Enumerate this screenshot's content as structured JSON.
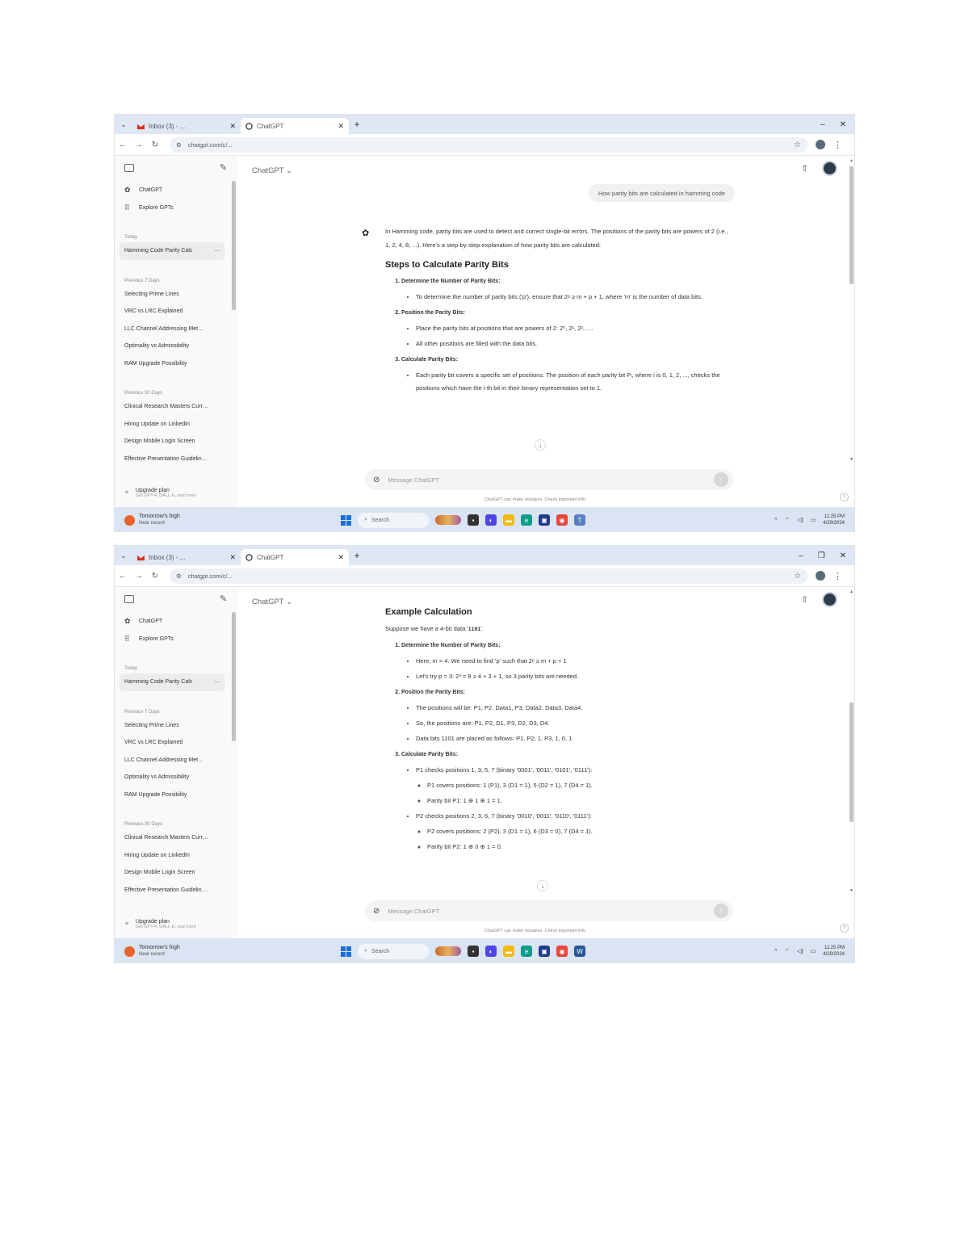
{
  "screenshots": [
    {
      "browser": {
        "tabs": [
          {
            "title": "Inbox (3) - ...",
            "active": false
          },
          {
            "title": "ChatGPT",
            "active": true
          }
        ],
        "url": "chatgpt.com/c/..."
      },
      "sidebar": {
        "items": [
          {
            "icon": "chatgpt-icon",
            "label": "ChatGPT"
          },
          {
            "icon": "explore-icon",
            "label": "Explore GPTs"
          }
        ],
        "groups": [
          {
            "label": "Today",
            "items": [
              "Hamming Code Parity Calc"
            ]
          },
          {
            "label": "Previous 7 Days",
            "items": [
              "Selecting Prime Lines",
              "VRC vs LRC Explained",
              "LLC Channel Addressing Met…",
              "Optimality vs Admissibility",
              "RAM Upgrade Possibility"
            ]
          },
          {
            "label": "Previous 30 Days",
            "items": [
              "Clinical Research Masters Curr…",
              "Hiring Update on LinkedIn",
              "Design Mobile Login Screen",
              "Effective Presentation Guidelin…"
            ]
          }
        ],
        "upgrade": {
          "title": "Upgrade plan",
          "subtitle": "Get GPT-4, DALL·E, and more"
        }
      },
      "main": {
        "model": "ChatGPT",
        "user_message": "How parity bits are calculated in hamming code",
        "intro": "In Hamming code, parity bits are used to detect and correct single-bit errors. The positions of the parity bits are powers of 2 (i.e., 1, 2, 4, 8, ...). Here's a step-by-step explanation of how parity bits are calculated:",
        "heading": "Steps to Calculate Parity Bits",
        "steps": [
          {
            "title": "Determine the Number of Parity Bits:",
            "bullets": [
              "To determine the number of parity bits ('p'), ensure that 2ᵖ ≥ m + p + 1, where 'm' is the number of data bits."
            ]
          },
          {
            "title": "Position the Parity Bits:",
            "bullets": [
              "Place the parity bits at positions that are powers of 2: 2⁰, 2¹, 2², ....",
              "All other positions are filled with the data bits."
            ]
          },
          {
            "title": "Calculate Parity Bits:",
            "bullets": [
              "Each parity bit covers a specific set of positions. The position of each parity bit Pᵢ, where i is 0, 1, 2, ..., checks the positions which have the i-th bit in their binary representation set to 1."
            ]
          }
        ],
        "composer_placeholder": "Message ChatGPT",
        "disclaimer": "ChatGPT can make mistakes. Check important info."
      },
      "taskbar": {
        "weather_title": "Tomorrow's high",
        "weather_sub": "Near record",
        "search": "Search",
        "time": "11:25 PM",
        "date": "4/29/2024"
      }
    },
    {
      "browser": {
        "tabs": [
          {
            "title": "Inbox (3) - ...",
            "active": false
          },
          {
            "title": "ChatGPT",
            "active": true
          }
        ],
        "url": "chatgpt.com/c/..."
      },
      "sidebar": {
        "items": [
          {
            "icon": "chatgpt-icon",
            "label": "ChatGPT"
          },
          {
            "icon": "explore-icon",
            "label": "Explore GPTs"
          }
        ],
        "groups": [
          {
            "label": "Today",
            "items": [
              "Hamming Code Parity Calc"
            ]
          },
          {
            "label": "Previous 7 Days",
            "items": [
              "Selecting Prime Lines",
              "VRC vs LRC Explained",
              "LLC Channel Addressing Met…",
              "Optimality vs Admissibility",
              "RAM Upgrade Possibility"
            ]
          },
          {
            "label": "Previous 30 Days",
            "items": [
              "Clinical Research Masters Curr…",
              "Hiring Update on LinkedIn",
              "Design Mobile Login Screen",
              "Effective Presentation Guidelin…"
            ]
          }
        ],
        "upgrade": {
          "title": "Upgrade plan",
          "subtitle": "Get GPT-4, DALL·E, and more"
        }
      },
      "main": {
        "model": "ChatGPT",
        "heading": "Example Calculation",
        "intro_pre": "Suppose we have a 4-bit data '",
        "intro_code": "1101",
        "intro_post": "'.",
        "steps": [
          {
            "title": "Determine the Number of Parity Bits:",
            "bullets": [
              "Here, m = 4. We need to find 'p' such that 2ᵖ ≥ m + p + 1",
              "Let's try p = 3: 2³ = 8 ≥ 4 + 3 + 1, so 3 parity bits are needed."
            ]
          },
          {
            "title": "Position the Parity Bits:",
            "bullets": [
              "The positions will be: P1, P2, Data1, P3, Data2, Data3, Data4.",
              "So, the positions are: P1, P2, D1, P3, D2, D3, D4.",
              "Data bits 1101 are placed as follows: P1, P2, 1, P3, 1, 0, 1"
            ]
          }
        ],
        "step3_title": "Calculate Parity Bits:",
        "p1": {
          "text": "P1 checks positions 1, 3, 5, 7 (binary '0001', '0011', '0101', '0111'):",
          "subs": [
            "P1 covers positions: 1 (P1), 3 (D1 = 1), 5 (D2 = 1), 7 (D4 = 1).",
            "Parity bit P1: 1 ⊕ 1 ⊕ 1 = 1."
          ]
        },
        "p2": {
          "text": "P2 checks positions 2, 3, 6, 7 (binary '0010', '0011', '0110', '0111'):",
          "subs": [
            "P2 covers positions: 2 (P2), 3 (D1 = 1), 6 (D3 = 0), 7 (D4 = 1).",
            "Parity bit P2: 1 ⊕ 0 ⊕ 1 = 0."
          ]
        },
        "composer_placeholder": "Message ChatGPT",
        "disclaimer": "ChatGPT can make mistakes. Check important info."
      },
      "taskbar": {
        "weather_title": "Tomorrow's high",
        "weather_sub": "Near record",
        "search": "Search",
        "time": "11:25 PM",
        "date": "4/29/2024"
      }
    }
  ],
  "colors": {
    "tabbar": "#dfe6f4",
    "sidebar": "#f9f9f9",
    "taskbar": "#dbe4f2",
    "accent": "#1f6fd6"
  }
}
